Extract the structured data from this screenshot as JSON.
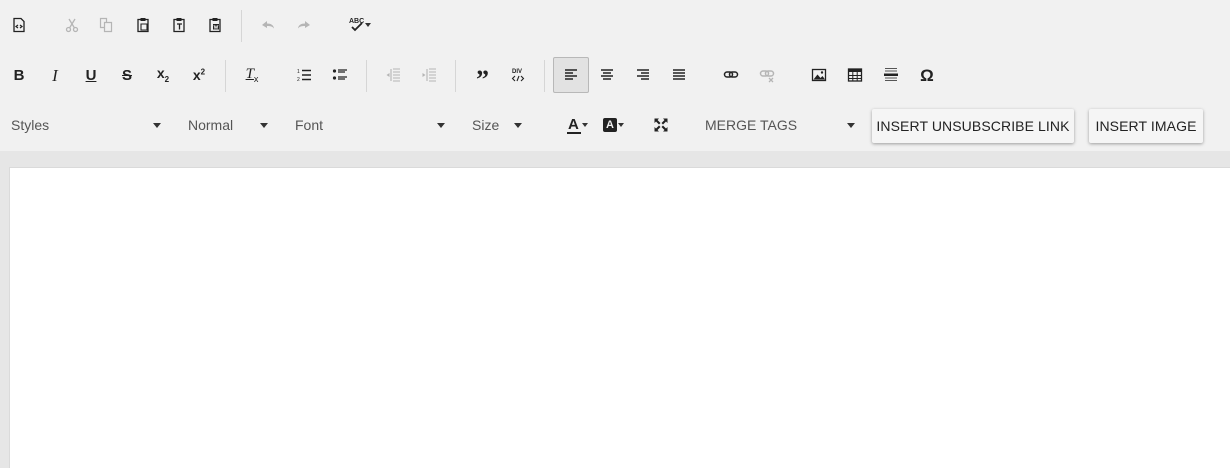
{
  "toolbar": {
    "row1": {
      "source": {
        "icon": "source-icon",
        "enabled": true
      },
      "cut": {
        "icon": "cut-icon",
        "enabled": false
      },
      "copy": {
        "icon": "copy-icon",
        "enabled": false
      },
      "paste": {
        "icon": "paste-icon",
        "enabled": true
      },
      "paste_text": {
        "icon": "paste-text-icon",
        "enabled": true
      },
      "paste_word": {
        "icon": "paste-word-icon",
        "enabled": true
      },
      "undo": {
        "icon": "undo-icon",
        "enabled": false
      },
      "redo": {
        "icon": "redo-icon",
        "enabled": false
      },
      "spellcheck": {
        "icon": "spellcheck-icon",
        "label": "ABC",
        "enabled": true
      }
    },
    "row2": {
      "bold": {
        "label": "B"
      },
      "italic": {
        "label": "I"
      },
      "underline": {
        "label": "U"
      },
      "strike": {
        "label": "S"
      },
      "subscript": {
        "label": "x",
        "sub": "2"
      },
      "superscript": {
        "label": "x",
        "sup": "2"
      },
      "remove_format": {
        "label": "T",
        "sub": "x"
      },
      "blockquote": {
        "label": "”"
      },
      "create_div": {
        "label": "DIV"
      },
      "align_active": "left",
      "special_char": {
        "label": "Ω"
      }
    },
    "row3": {
      "styles": {
        "label": "Styles"
      },
      "format": {
        "label": "Normal"
      },
      "font": {
        "label": "Font"
      },
      "size": {
        "label": "Size"
      },
      "text_color": {
        "label": "A"
      },
      "bg_color": {
        "label": "A"
      },
      "merge_tags": {
        "label": "MERGE TAGS"
      },
      "insert_unsubscribe": {
        "label": "INSERT UNSUBSCRIBE LINK"
      },
      "insert_image": {
        "label": "INSERT IMAGE"
      }
    }
  },
  "colors": {
    "toolbar_bg": "#f1f1f1",
    "icon": "#222222",
    "icon_disabled": "#b5b5b5",
    "content_bg": "#ffffff",
    "page_bg": "#e6e6e6"
  }
}
